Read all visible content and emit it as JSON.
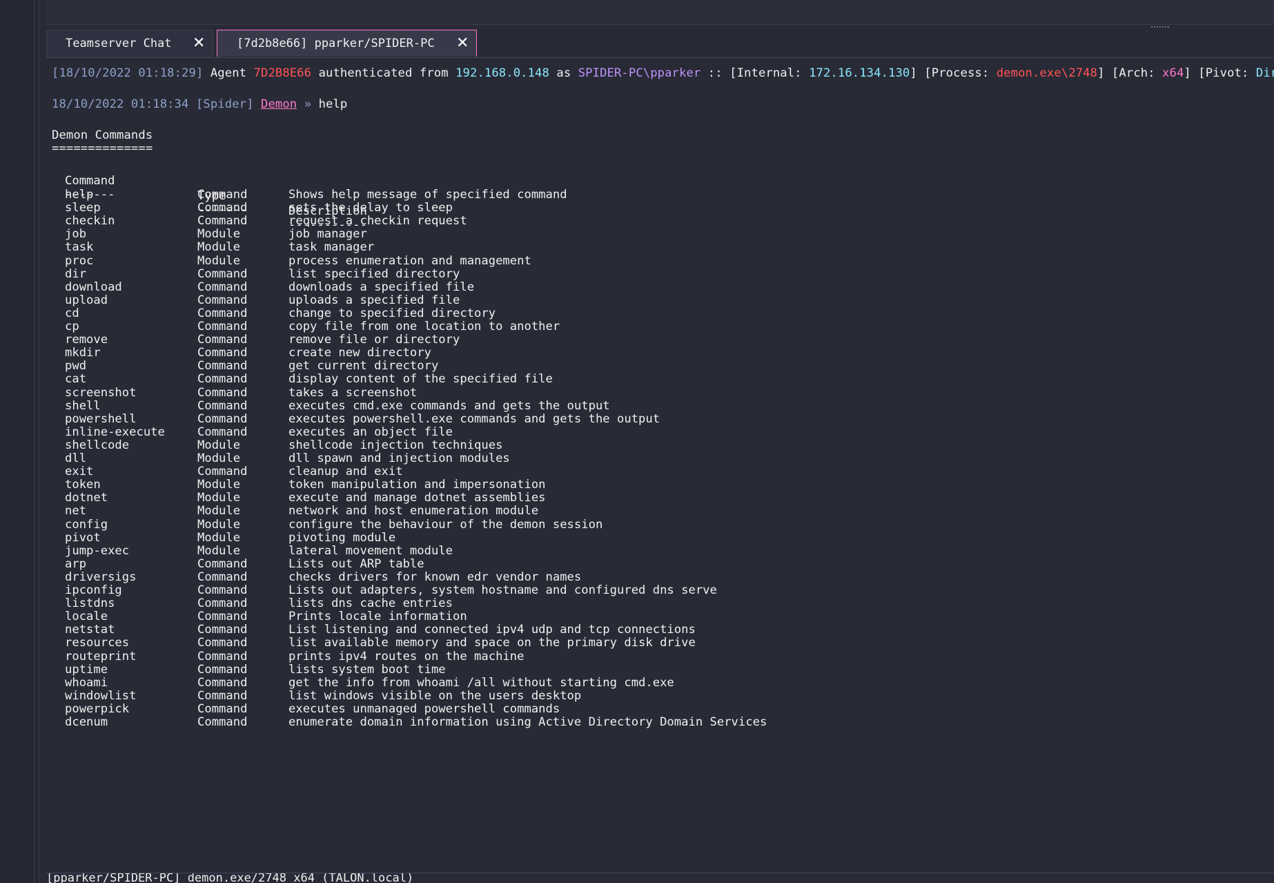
{
  "tabs": [
    {
      "label": "Teamserver Chat",
      "close": "✕"
    },
    {
      "label": "[7d2b8e66] pparker/SPIDER-PC",
      "close": "✕"
    }
  ],
  "auth_line": {
    "ts": "[18/10/2022 01:18:29]",
    "agent_word": " Agent ",
    "agent_id": "7D2B8E66",
    "auth_from": " authenticated from ",
    "ip": "192.168.0.148",
    "as_word": " as ",
    "user": "SPIDER-PC\\pparker",
    "internal_open": " :: [Internal: ",
    "internal_ip": "172.16.134.130",
    "process_open": "] [Process: ",
    "process": "demon.exe\\2748",
    "arch_open": "] [Arch: ",
    "arch": "x64",
    "pivot_open": "] [Pivot: ",
    "pivot": "Direct",
    "close": "]"
  },
  "prompt_line": {
    "ts": "18/10/2022 01:18:34 [Spider] ",
    "agent": "Demon",
    "arrow": " » ",
    "command": "help"
  },
  "heading": "Demon Commands",
  "heading_underline": "==============",
  "table_header": {
    "command": "Command",
    "type": "Type",
    "description": "Description"
  },
  "table_rule": {
    "command": "-------",
    "type": "-------",
    "description": "-----------"
  },
  "commands": [
    {
      "command": "help",
      "type": "Command",
      "description": "Shows help message of specified command"
    },
    {
      "command": "sleep",
      "type": "Command",
      "description": "sets the delay to sleep"
    },
    {
      "command": "checkin",
      "type": "Command",
      "description": "request a checkin request"
    },
    {
      "command": "job",
      "type": "Module",
      "description": "job manager"
    },
    {
      "command": "task",
      "type": "Module",
      "description": "task manager"
    },
    {
      "command": "proc",
      "type": "Module",
      "description": "process enumeration and management"
    },
    {
      "command": "dir",
      "type": "Command",
      "description": "list specified directory"
    },
    {
      "command": "download",
      "type": "Command",
      "description": "downloads a specified file"
    },
    {
      "command": "upload",
      "type": "Command",
      "description": "uploads a specified file"
    },
    {
      "command": "cd",
      "type": "Command",
      "description": "change to specified directory"
    },
    {
      "command": "cp",
      "type": "Command",
      "description": "copy file from one location to another"
    },
    {
      "command": "remove",
      "type": "Command",
      "description": "remove file or directory"
    },
    {
      "command": "mkdir",
      "type": "Command",
      "description": "create new directory"
    },
    {
      "command": "pwd",
      "type": "Command",
      "description": "get current directory"
    },
    {
      "command": "cat",
      "type": "Command",
      "description": "display content of the specified file"
    },
    {
      "command": "screenshot",
      "type": "Command",
      "description": "takes a screenshot"
    },
    {
      "command": "shell",
      "type": "Command",
      "description": "executes cmd.exe commands and gets the output"
    },
    {
      "command": "powershell",
      "type": "Command",
      "description": "executes powershell.exe commands and gets the output"
    },
    {
      "command": "inline-execute",
      "type": "Command",
      "description": "executes an object file"
    },
    {
      "command": "shellcode",
      "type": "Module",
      "description": "shellcode injection techniques"
    },
    {
      "command": "dll",
      "type": "Module",
      "description": "dll spawn and injection modules"
    },
    {
      "command": "exit",
      "type": "Command",
      "description": "cleanup and exit"
    },
    {
      "command": "token",
      "type": "Module",
      "description": "token manipulation and impersonation"
    },
    {
      "command": "dotnet",
      "type": "Module",
      "description": "execute and manage dotnet assemblies"
    },
    {
      "command": "net",
      "type": "Module",
      "description": "network and host enumeration module"
    },
    {
      "command": "config",
      "type": "Module",
      "description": "configure the behaviour of the demon session"
    },
    {
      "command": "pivot",
      "type": "Module",
      "description": "pivoting module"
    },
    {
      "command": "jump-exec",
      "type": "Module",
      "description": "lateral movement module"
    },
    {
      "command": "arp",
      "type": "Command",
      "description": "Lists out ARP table"
    },
    {
      "command": "driversigs",
      "type": "Command",
      "description": "checks drivers for known edr vendor names"
    },
    {
      "command": "ipconfig",
      "type": "Command",
      "description": "Lists out adapters, system hostname and configured dns serve"
    },
    {
      "command": "listdns",
      "type": "Command",
      "description": "lists dns cache entries"
    },
    {
      "command": "locale",
      "type": "Command",
      "description": "Prints locale information"
    },
    {
      "command": "netstat",
      "type": "Command",
      "description": "List listening and connected ipv4 udp and tcp connections"
    },
    {
      "command": "resources",
      "type": "Command",
      "description": "list available memory and space on the primary disk drive"
    },
    {
      "command": "routeprint",
      "type": "Command",
      "description": "prints ipv4 routes on the machine"
    },
    {
      "command": "uptime",
      "type": "Command",
      "description": "lists system boot time"
    },
    {
      "command": "whoami",
      "type": "Command",
      "description": "get the info from whoami /all without starting cmd.exe"
    },
    {
      "command": "windowlist",
      "type": "Command",
      "description": "list windows visible on the users desktop"
    },
    {
      "command": "powerpick",
      "type": "Command",
      "description": "executes unmanaged powershell commands"
    },
    {
      "command": "dcenum",
      "type": "Command",
      "description": "enumerate domain information using Active Directory Domain Services"
    }
  ],
  "status_bar": "[pparker/SPIDER-PC] demon.exe/2748 x64 (TALON.local)"
}
